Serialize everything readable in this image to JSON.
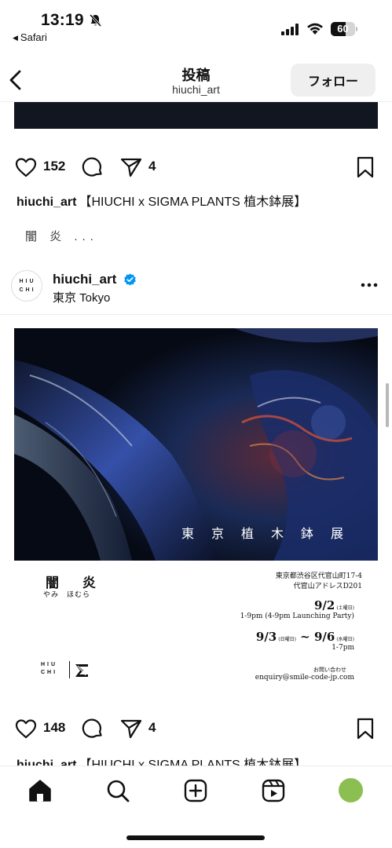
{
  "status_bar": {
    "time": "13:19",
    "back_app": "Safari",
    "battery": "60",
    "battery_level": 0.6
  },
  "nav": {
    "title": "投稿",
    "subtitle": "hiuchi_art",
    "follow_label": "フォロー"
  },
  "post1": {
    "likes": "152",
    "shares": "4",
    "caption_user": "hiuchi_art",
    "caption_text": "【HIUCHI x SIGMA PLANTS 植木鉢展】",
    "more_text": "闇 炎 ..."
  },
  "post2": {
    "avatar_text_top": "HIU",
    "avatar_text_bottom": "CHI",
    "username": "hiuchi_art",
    "location": "東京 Tokyo",
    "image": {
      "overlay_text": "東京植木鉢展",
      "flyer_title": "闇 炎",
      "flyer_reading": "やみ　ほむら",
      "address_line1": "東京都渋谷区代官山町17-4",
      "address_line2": "代官山アドレスD201",
      "date1": "9/2",
      "date1_day": "(土曜日)",
      "time1": "1-9pm (4-9pm Launching Party)",
      "date2_start": "9/3",
      "date2_start_day": "(日曜日)",
      "date2_sep": " ~ ",
      "date2_end": "9/6",
      "date2_end_day": "(水曜日)",
      "time2": "1-7pm",
      "contact_label": "お問い合わせ",
      "contact_email": "enquiry@smile-code-jp.com",
      "logo_top": "HIU",
      "logo_bottom": "CHI"
    },
    "likes": "148",
    "shares": "4",
    "caption_user": "hiuchi_art",
    "caption_text": "【HIUCHI x SIGMA PLANTS 植木鉢展】"
  },
  "tab_bar": {
    "items": [
      "home-icon",
      "search-icon",
      "create-icon",
      "reels-icon",
      "profile-avatar"
    ],
    "avatar_color": "#8cbf52"
  },
  "colors": {
    "accent_verified": "#0095f6",
    "follow_bg": "#efefef"
  }
}
